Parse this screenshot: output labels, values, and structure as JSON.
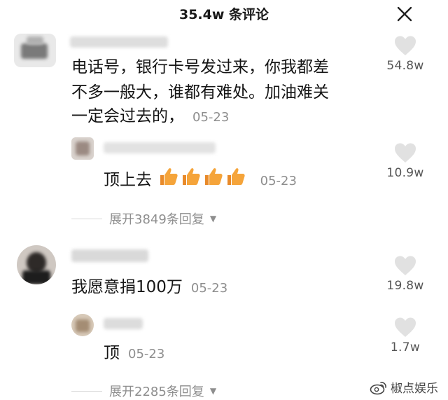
{
  "header": {
    "title": "35.4w 条评论"
  },
  "comments": [
    {
      "text_lines": [
        "电话号，银行卡号发过来，你我都差",
        "不多一般大，谁都有难处。加油难关",
        "一定会过去的，"
      ],
      "date": "05-23",
      "likes": "54.8w",
      "replies": [
        {
          "text": "顶上去",
          "emoji_count": 4,
          "date": "05-23",
          "likes": "10.9w"
        }
      ],
      "expand_label": "展开3849条回复"
    },
    {
      "text_lines": [
        "我愿意捐100万"
      ],
      "date": "05-23",
      "likes": "19.8w",
      "replies": [
        {
          "text": "顶",
          "date": "05-23",
          "likes": "1.7w"
        }
      ],
      "expand_label": "展开2285条回复"
    }
  ],
  "watermark": {
    "text": "椒点娱乐"
  },
  "colors": {
    "date": "#8e8e8e",
    "heart": "#e1e1e1",
    "thumb": "#f5a43a"
  },
  "icons": {
    "close": "close-icon",
    "like": "heart-icon",
    "thumb": "thumbs-up-emoji",
    "weibo": "weibo-logo-icon"
  }
}
